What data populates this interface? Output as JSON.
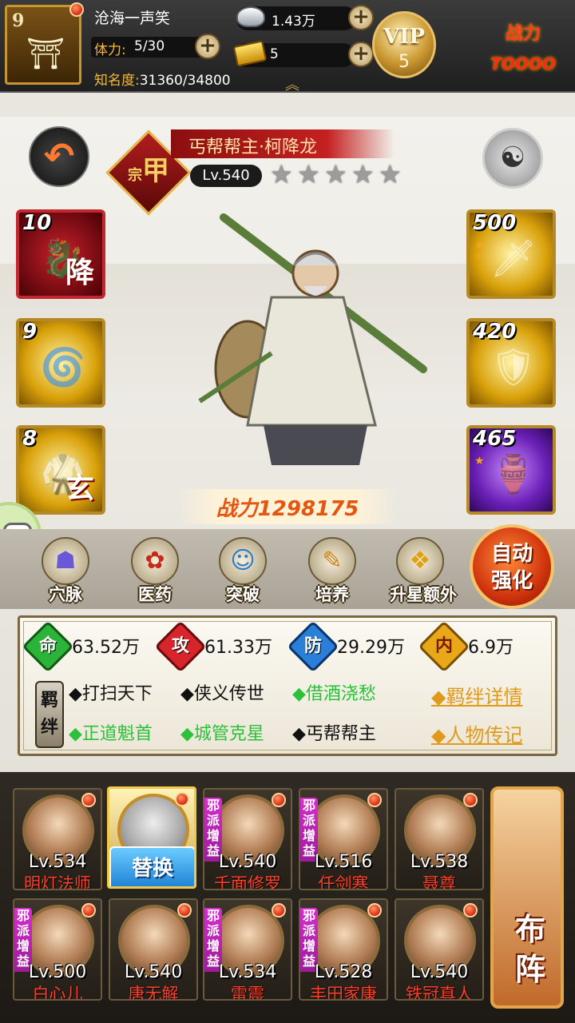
{
  "player": {
    "level": "9",
    "name": "沧海一声笑",
    "stamina_label": "体力:",
    "stamina_value": "5/30",
    "fame_label": "知名度:",
    "fame_value": "31360/34800"
  },
  "resources": {
    "silver": "1.43万",
    "gold": "5"
  },
  "vip": {
    "label": "VIP",
    "level": "5"
  },
  "combat_top": {
    "label": "战力",
    "value": "TOOOO"
  },
  "hero": {
    "title": "丐帮帮主·柯降龙",
    "rank": "甲",
    "rank_prefix": "宗",
    "level": "Lv.540",
    "stars": 5,
    "power": "战力1298175"
  },
  "skills": [
    {
      "count": "10",
      "char": "降",
      "color": "red"
    },
    {
      "count": "9",
      "char": "",
      "color": "gold"
    },
    {
      "count": "8",
      "char": "玄",
      "color": "gold"
    }
  ],
  "equips": [
    {
      "count": "500",
      "stars": 2,
      "color": "gold"
    },
    {
      "count": "420",
      "stars": 0,
      "color": "gold"
    },
    {
      "count": "465",
      "stars": 1,
      "color": "purple"
    }
  ],
  "actions": [
    {
      "label": "穴脉",
      "icon": "meridian-icon"
    },
    {
      "label": "医药",
      "icon": "medicine-icon"
    },
    {
      "label": "突破",
      "icon": "breakthrough-icon"
    },
    {
      "label": "培养",
      "icon": "cultivate-icon"
    },
    {
      "label": "升星额外",
      "icon": "star-up-icon"
    }
  ],
  "auto_enhance": "自动强化",
  "stats": [
    {
      "key": "命",
      "value": "63.52万",
      "color": "#2bb33a"
    },
    {
      "key": "攻",
      "value": "61.33万",
      "color": "#d8252b"
    },
    {
      "key": "防",
      "value": "29.29万",
      "color": "#2a7fd8"
    },
    {
      "key": "内",
      "value": "6.9万",
      "color": "#e9a818"
    }
  ],
  "bonds_label": "羁绊",
  "bonds": [
    {
      "text": "◆打扫天下",
      "active": false
    },
    {
      "text": "◆侠义传世",
      "active": false
    },
    {
      "text": "◆借酒浇愁",
      "active": true
    },
    {
      "text": "◆正道魁首",
      "active": true
    },
    {
      "text": "◆城管克星",
      "active": true
    },
    {
      "text": "◆丐帮帮主",
      "active": false
    }
  ],
  "links": {
    "bond_detail": "◆羁绊详情",
    "biography": "◆人物传记"
  },
  "team": [
    {
      "level": "Lv.534",
      "name": "明灯法师",
      "tag": ""
    },
    {
      "level": "",
      "name": "",
      "tag": "",
      "swap": "替换"
    },
    {
      "level": "Lv.540",
      "name": "千面修罗",
      "tag": "邪派增益"
    },
    {
      "level": "Lv.516",
      "name": "任剑寒",
      "tag": "邪派增益"
    },
    {
      "level": "Lv.538",
      "name": "聂尊",
      "tag": ""
    },
    {
      "level": "Lv.500",
      "name": "白心儿",
      "tag": "邪派增益"
    },
    {
      "level": "Lv.540",
      "name": "唐无解",
      "tag": ""
    },
    {
      "level": "Lv.534",
      "name": "雷震",
      "tag": "邪派增益"
    },
    {
      "level": "Lv.528",
      "name": "丰田家康",
      "tag": "邪派增益"
    },
    {
      "level": "Lv.540",
      "name": "铁冠真人",
      "tag": ""
    }
  ],
  "formation": "布阵"
}
